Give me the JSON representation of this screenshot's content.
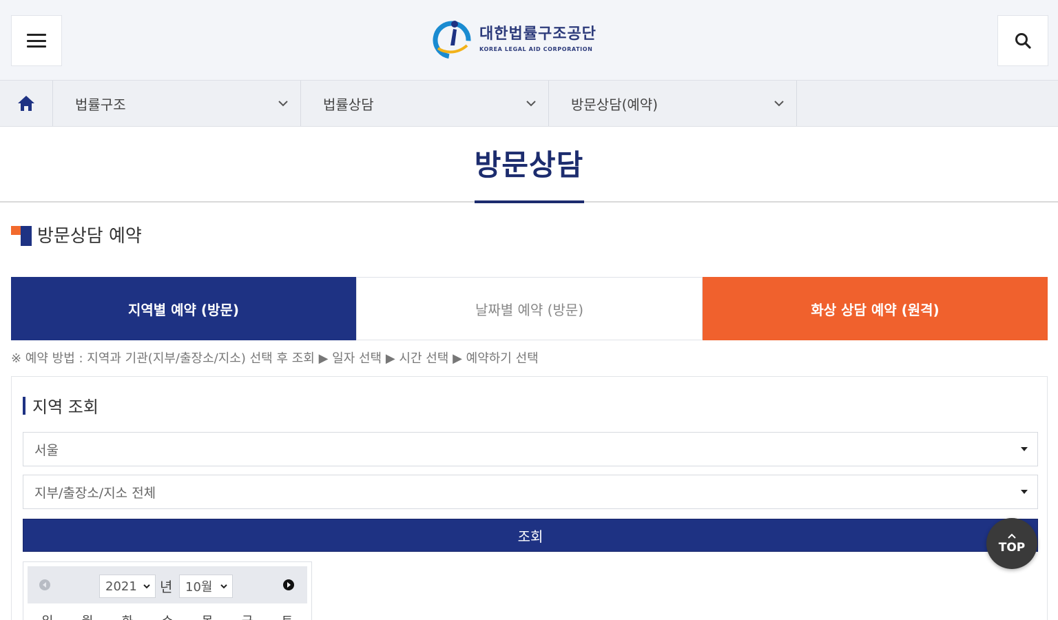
{
  "header": {
    "logo_ko": "대한법률구조공단",
    "logo_en": "KOREA LEGAL AID CORPORATION"
  },
  "nav": {
    "items": [
      {
        "label": "법률구조"
      },
      {
        "label": "법률상담"
      },
      {
        "label": "방문상담(예약)"
      }
    ]
  },
  "page": {
    "title": "방문상담",
    "section_title": "방문상담 예약"
  },
  "tabs": [
    {
      "label": "지역별 예약 (방문)"
    },
    {
      "label": "날짜별 예약 (방문)"
    },
    {
      "label": "화상 상담 예약 (원격)"
    }
  ],
  "method_text": "※ 예약 방법 : 지역과 기관(지부/출장소/지소) 선택 후 조회 ▶ 일자 선택 ▶ 시간 선택 ▶ 예약하기 선택",
  "region_search": {
    "title": "지역 조회",
    "region_select": "서울",
    "office_select": "지부/출장소/지소 전체",
    "search_button": "조회"
  },
  "calendar": {
    "year": "2021",
    "year_unit": "년",
    "month": "10월",
    "weekdays": [
      "일",
      "월",
      "화",
      "수",
      "목",
      "금",
      "토"
    ]
  },
  "top_button": "TOP",
  "colors": {
    "navy": "#1e3283",
    "orange": "#f0612d"
  }
}
